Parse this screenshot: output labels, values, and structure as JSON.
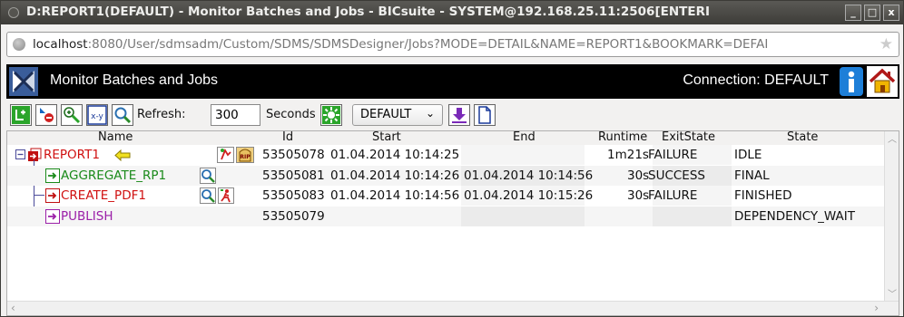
{
  "window": {
    "title": "D:REPORT1(DEFAULT) - Monitor Batches and Jobs - BICsuite - SYSTEM@192.168.25.11:2506[ENTERI",
    "buttons": [
      "_",
      "□",
      "x"
    ]
  },
  "browser": {
    "url_host": "localhost",
    "url_rest": ":8080/User/sdmsadm/Custom/SDMS/SDMSDesigner/Jobs?MODE=DETAIL&NAME=REPORT1&BOOKMARK=DEFAI"
  },
  "app": {
    "title": "Monitor Batches and Jobs",
    "connection": "Connection: DEFAULT"
  },
  "toolbar": {
    "refresh_label": "Refresh:",
    "refresh_value": "300",
    "seconds_label": "Seconds",
    "bookmark_value": "DEFAULT",
    "xy_label": "x-y"
  },
  "table": {
    "headers": {
      "name": "Name",
      "id": "Id",
      "start": "Start",
      "end": "End",
      "runtime": "Runtime",
      "exitstate": "ExitState",
      "state": "State"
    },
    "rows": [
      {
        "name": "REPORT1",
        "id": "53505078",
        "start": "01.04.2014 10:14:25",
        "end": "",
        "runtime": "1m21s",
        "exitstate": "FAILURE",
        "state": "IDLE"
      },
      {
        "name": "AGGREGATE_RP1",
        "id": "53505081",
        "start": "01.04.2014 10:14:26",
        "end": "01.04.2014 10:14:56",
        "runtime": "30s",
        "exitstate": "SUCCESS",
        "state": "FINAL"
      },
      {
        "name": "CREATE_PDF1",
        "id": "53505083",
        "start": "01.04.2014 10:14:56",
        "end": "01.04.2014 10:15:26",
        "runtime": "30s",
        "exitstate": "FAILURE",
        "state": "FINISHED"
      },
      {
        "name": "PUBLISH",
        "id": "53505079",
        "start": "",
        "end": "",
        "runtime": "",
        "exitstate": "",
        "state": "DEPENDENCY_WAIT"
      }
    ],
    "icon_text": {
      "rip": "RIP"
    }
  },
  "colors": {
    "failure_name": "#d01010",
    "success_name": "#1a8a1a",
    "pending_name": "#9b1fa8",
    "header_bg": "#000000"
  }
}
